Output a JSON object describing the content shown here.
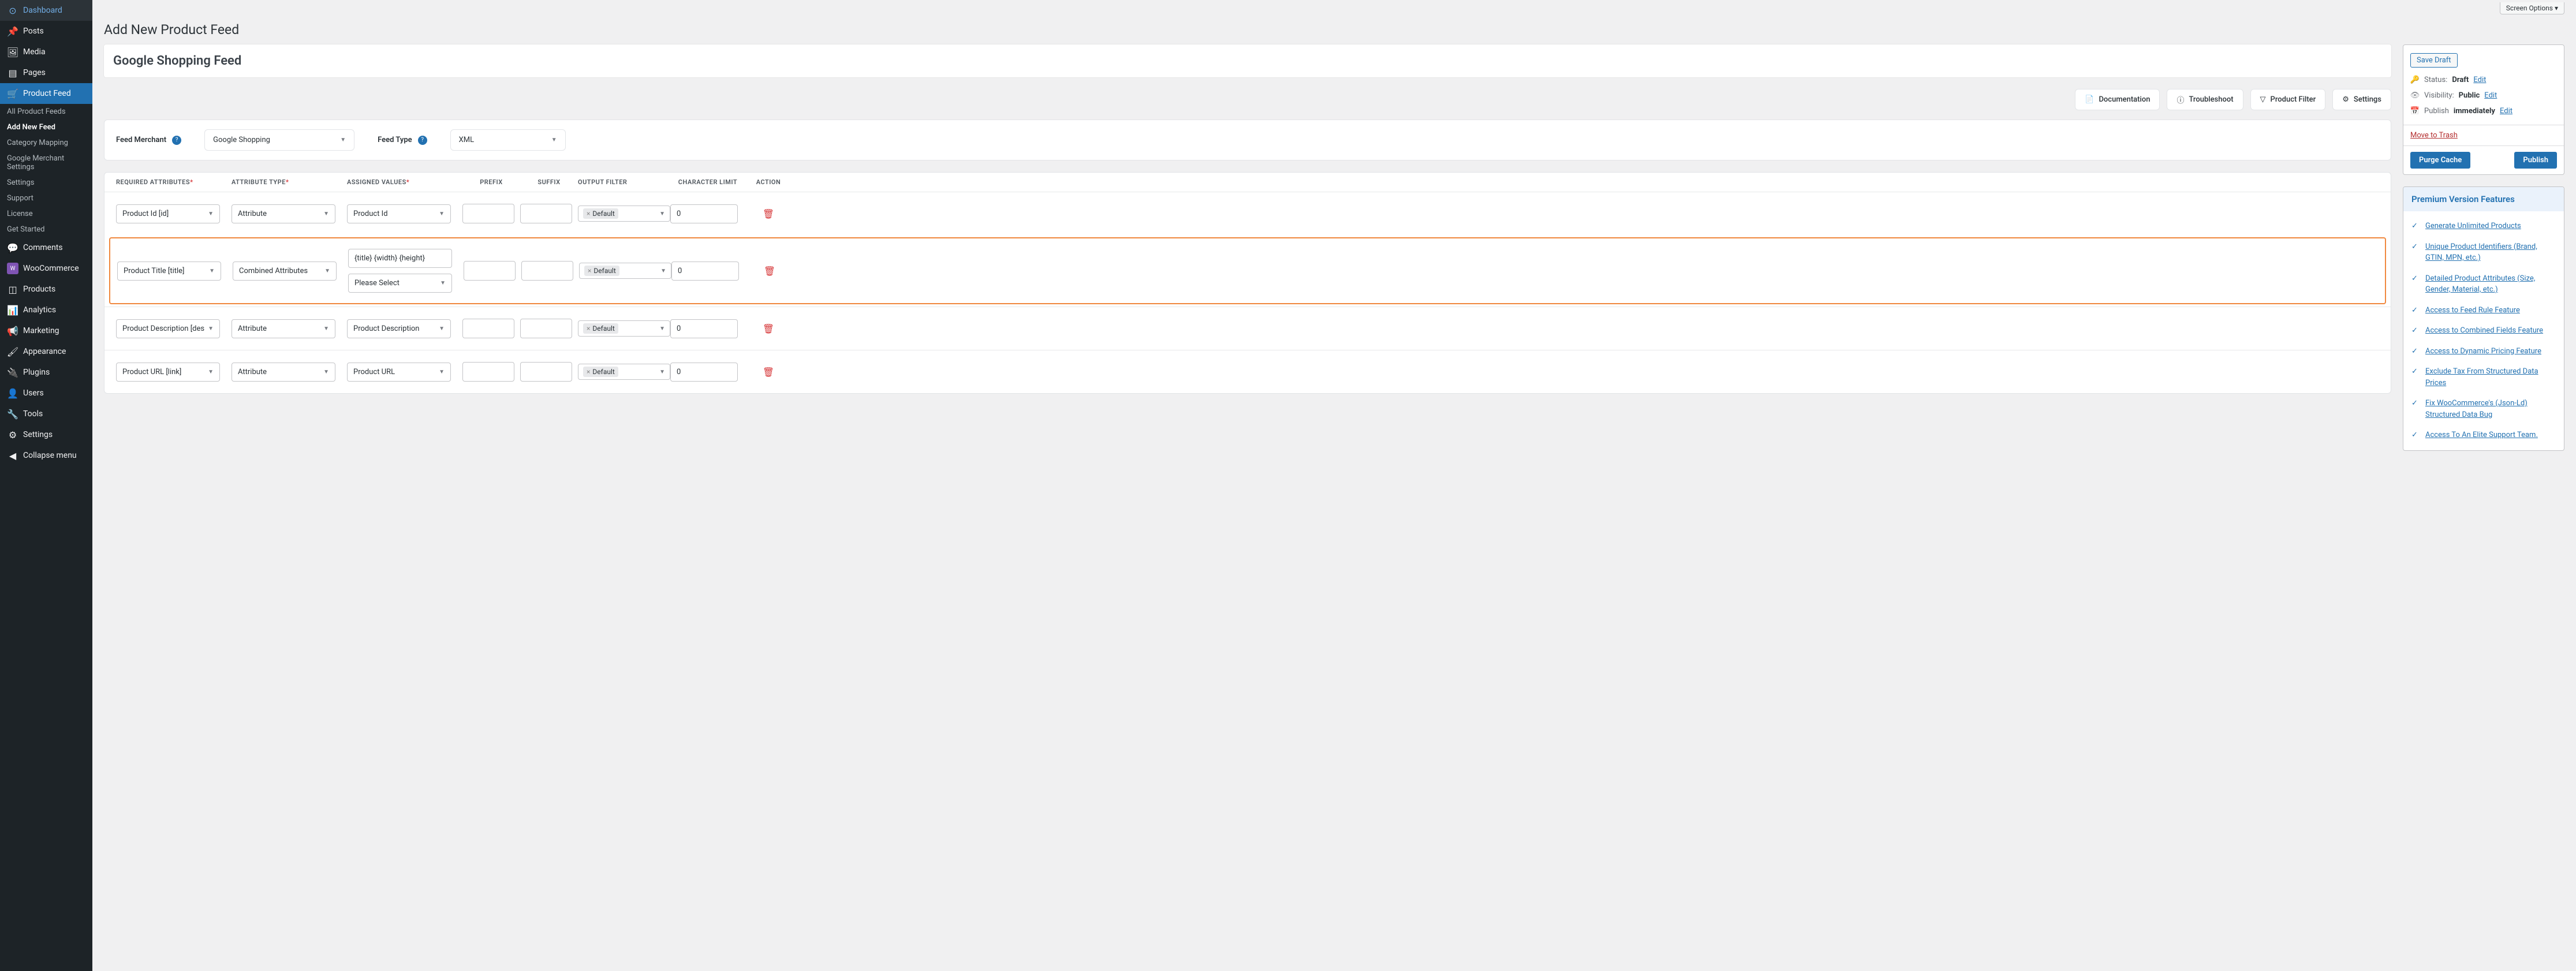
{
  "screenOptions": "Screen Options ▾",
  "pageTitle": "Add New Product Feed",
  "feedTitle": "Google Shopping Feed",
  "sidebar": {
    "items": [
      {
        "label": "Dashboard",
        "icon": "⌂"
      },
      {
        "label": "Posts",
        "icon": "✎"
      },
      {
        "label": "Media",
        "icon": "🖾"
      },
      {
        "label": "Pages",
        "icon": "▤"
      },
      {
        "label": "Product Feed",
        "icon": "🛒",
        "active": true
      },
      {
        "label": "Comments",
        "icon": "💬"
      },
      {
        "label": "WooCommerce",
        "icon": "ⓦ"
      },
      {
        "label": "Products",
        "icon": "◫"
      },
      {
        "label": "Analytics",
        "icon": "📊"
      },
      {
        "label": "Marketing",
        "icon": "📢"
      },
      {
        "label": "Appearance",
        "icon": "🖌"
      },
      {
        "label": "Plugins",
        "icon": "🔌"
      },
      {
        "label": "Users",
        "icon": "👤"
      },
      {
        "label": "Tools",
        "icon": "🔧"
      },
      {
        "label": "Settings",
        "icon": "⚙"
      },
      {
        "label": "Collapse menu",
        "icon": "◀"
      }
    ],
    "sub": [
      {
        "label": "All Product Feeds"
      },
      {
        "label": "Add New Feed",
        "active": true
      },
      {
        "label": "Category Mapping"
      },
      {
        "label": "Google Merchant Settings"
      },
      {
        "label": "Settings"
      },
      {
        "label": "Support"
      },
      {
        "label": "License"
      },
      {
        "label": "Get Started"
      }
    ]
  },
  "actionButtons": {
    "doc": "Documentation",
    "trouble": "Troubleshoot",
    "filter": "Product Filter",
    "settings": "Settings"
  },
  "config": {
    "merchantLabel": "Feed Merchant",
    "merchantValue": "Google Shopping",
    "typeLabel": "Feed Type",
    "typeValue": "XML"
  },
  "tableHeaders": {
    "req": "Required Attributes",
    "type": "Attribute Type",
    "val": "Assigned Values",
    "prefix": "Prefix",
    "suffix": "Suffix",
    "filter": "Output Filter",
    "limit": "Character Limit",
    "action": "Action"
  },
  "rows": [
    {
      "req": "Product Id [id]",
      "type": "Attribute",
      "val": "Product Id",
      "filter": "Default",
      "limit": "0"
    },
    {
      "req": "Product Title [title]",
      "type": "Combined Attributes",
      "val": "{title} {width} {height}",
      "val2": "Please Select",
      "filter": "Default",
      "limit": "0",
      "highlighted": true
    },
    {
      "req": "Product Description [des",
      "type": "Attribute",
      "val": "Product Description",
      "filter": "Default",
      "limit": "0"
    },
    {
      "req": "Product URL [link]",
      "type": "Attribute",
      "val": "Product URL",
      "filter": "Default",
      "limit": "0"
    }
  ],
  "publish": {
    "saveDraft": "Save Draft",
    "status": {
      "label": "Status:",
      "value": "Draft",
      "edit": "Edit"
    },
    "visibility": {
      "label": "Visibility:",
      "value": "Public",
      "edit": "Edit"
    },
    "schedule": {
      "label": "Publish",
      "value": "immediately",
      "edit": "Edit"
    },
    "trash": "Move to Trash",
    "purge": "Purge Cache",
    "pub": "Publish"
  },
  "features": {
    "title": "Premium Version Features",
    "items": [
      "Generate Unlimited Products",
      "Unique Product Identifiers (Brand, GTIN, MPN, etc.)",
      "Detailed Product Attributes (Size, Gender, Material, etc.)",
      "Access to Feed Rule Feature",
      "Access to Combined Fields Feature",
      "Access to Dynamic Pricing Feature",
      "Exclude Tax From Structured Data Prices",
      "Fix WooCommerce's (Json-Ld) Structured Data Bug",
      "Access To An Elite Support Team."
    ]
  }
}
